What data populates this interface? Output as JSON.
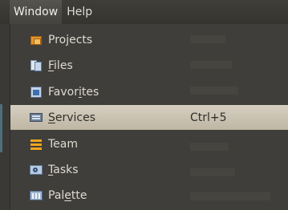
{
  "menubar": {
    "items": [
      {
        "label": "Window"
      },
      {
        "label": "Help"
      }
    ]
  },
  "menu": {
    "items": [
      {
        "before": "Pro",
        "mnemonic": "j",
        "after": "ects",
        "icon": "projects-icon"
      },
      {
        "before": "",
        "mnemonic": "F",
        "after": "iles",
        "icon": "files-icon"
      },
      {
        "before": "Favor",
        "mnemonic": "i",
        "after": "tes",
        "icon": "favorites-icon"
      },
      {
        "before": "",
        "mnemonic": "S",
        "after": "ervices",
        "icon": "services-icon",
        "shortcut": "Ctrl+5",
        "active": true
      },
      {
        "before": "Team",
        "mnemonic": "",
        "after": "",
        "icon": "team-icon"
      },
      {
        "before": "",
        "mnemonic": "T",
        "after": "asks",
        "icon": "tasks-icon"
      },
      {
        "before": "Pal",
        "mnemonic": "e",
        "after": "tte",
        "icon": "palette-icon"
      }
    ]
  },
  "colors": {
    "menu_background": "#3f3e3a",
    "highlight_background": "#cfc7b6",
    "text": "#dfdbd2",
    "text_on_highlight": "#2f2e2a"
  }
}
